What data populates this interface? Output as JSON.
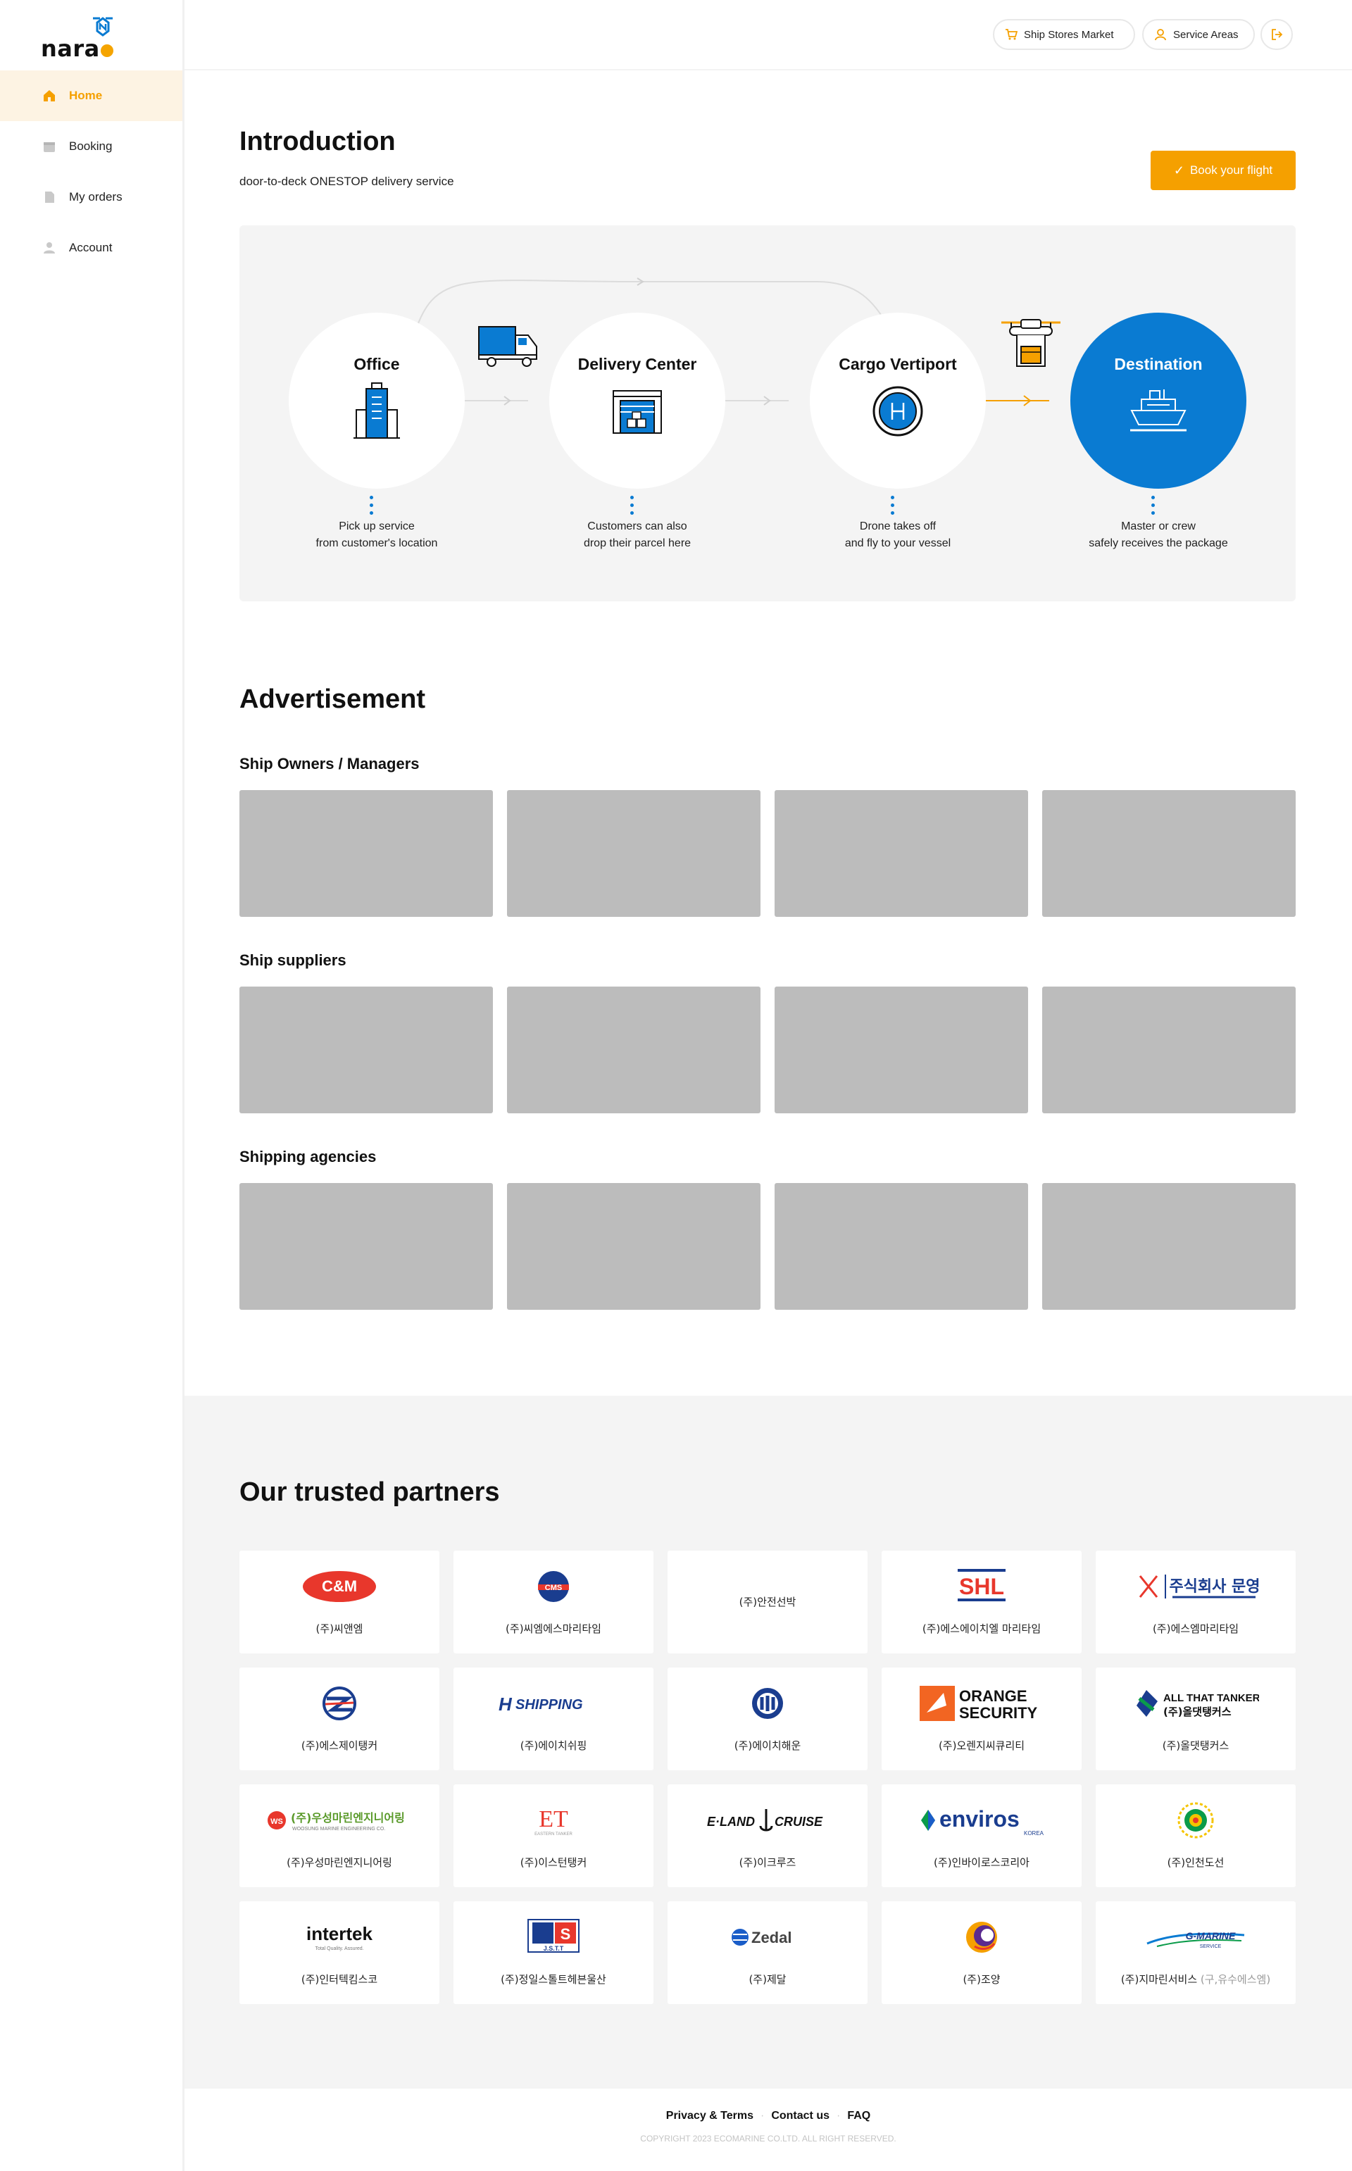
{
  "brand": {
    "logo_text_left": "nara",
    "logo_text_right": "n",
    "accent": "#f5a000",
    "blue": "#0a7bd2"
  },
  "sidebar": {
    "items": [
      {
        "label": "Home",
        "icon": "home-icon",
        "active": true
      },
      {
        "label": "Booking",
        "icon": "calendar-icon",
        "active": false
      },
      {
        "label": "My orders",
        "icon": "document-icon",
        "active": false
      },
      {
        "label": "Account",
        "icon": "user-icon",
        "active": false
      }
    ]
  },
  "header": {
    "market_label": "Ship Stores Market",
    "areas_label": "Service Areas",
    "logout_icon": "logout-icon"
  },
  "intro": {
    "title": "Introduction",
    "subtitle": "door-to-deck ONESTOP delivery service",
    "book_label": "Book your flight",
    "steps": [
      {
        "title": "Office",
        "desc1": "Pick up service",
        "desc2": "from customer's location",
        "icon": "office-building-icon"
      },
      {
        "title": "Delivery Center",
        "desc1": "Customers can also",
        "desc2": "drop their parcel here",
        "icon": "warehouse-icon"
      },
      {
        "title": "Cargo Vertiport",
        "desc1": "Drone takes off",
        "desc2": "and fly to your vessel",
        "icon": "helipad-icon"
      },
      {
        "title": "Destination",
        "desc1": "Master or crew",
        "desc2": "safely receives the package",
        "icon": "ship-icon"
      }
    ]
  },
  "ads": {
    "title": "Advertisement",
    "groups": [
      {
        "label": "Ship Owners / Managers"
      },
      {
        "label": "Ship suppliers"
      },
      {
        "label": "Shipping agencies"
      }
    ]
  },
  "partners": {
    "title": "Our trusted partners",
    "items": [
      {
        "name": "(주)씨앤엠",
        "logo": "C&M"
      },
      {
        "name": "(주)씨엠에스마리타임",
        "logo": "CMS"
      },
      {
        "name": "(주)안전선박",
        "logo": ""
      },
      {
        "name": "(주)에스에이치엘 마리타임",
        "logo": "SHL"
      },
      {
        "name": "(주)에스엠마리타임",
        "logo": "주식회사 문영"
      },
      {
        "name": "(주)에스제이탱커",
        "logo": ""
      },
      {
        "name": "(주)에이치쉬핑",
        "logo": "SHIPPING"
      },
      {
        "name": "(주)에이치해운",
        "logo": ""
      },
      {
        "name": "(주)오렌지씨큐리티",
        "logo": "ORANGE SECURITY"
      },
      {
        "name": "(주)올댓탱커스",
        "logo": "ALL THAT TANKERS"
      },
      {
        "name": "(주)우성마린엔지니어링",
        "logo": "(주)우성마린엔지니어링"
      },
      {
        "name": "(주)이스턴탱커",
        "logo": "ET"
      },
      {
        "name": "(주)이크루즈",
        "logo": "E-LAND CRUISE"
      },
      {
        "name": "(주)인바이로스코리아",
        "logo": "enviros"
      },
      {
        "name": "(주)인천도선",
        "logo": ""
      },
      {
        "name": "(주)인터텍킴스코",
        "logo": "intertek"
      },
      {
        "name": "(주)정일스톨트헤븐울산",
        "logo": "J.S.T.T"
      },
      {
        "name": "(주)제달",
        "logo": "Zedal"
      },
      {
        "name": "(주)조양",
        "logo": ""
      },
      {
        "name": "(주)지마린서비스",
        "name_suffix": "(구,유수에스엠)",
        "logo": "G-MARINE SERVICE"
      }
    ]
  },
  "footer": {
    "privacy": "Privacy & Terms",
    "contact": "Contact us",
    "faq": "FAQ",
    "copyright": "COPYRIGHT 2023 ECOMARINE CO.LTD. ALL RIGHT RESERVED."
  }
}
